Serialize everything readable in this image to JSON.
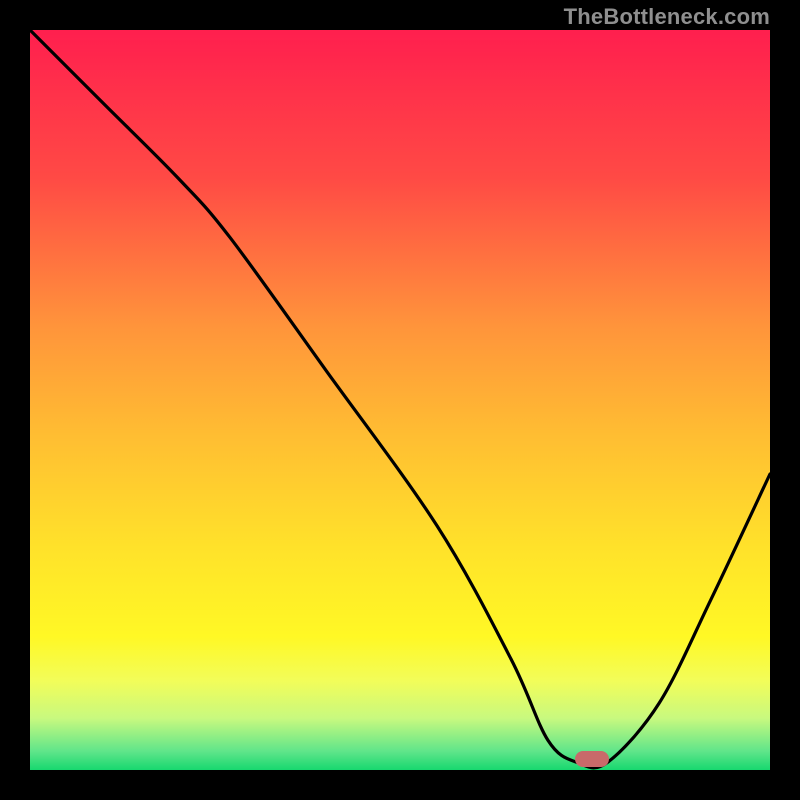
{
  "watermark": "TheBottleneck.com",
  "chart_data": {
    "type": "line",
    "title": "",
    "xlabel": "",
    "ylabel": "",
    "xlim": [
      0,
      100
    ],
    "ylim": [
      0,
      100
    ],
    "series": [
      {
        "name": "bottleneck-curve",
        "x": [
          0,
          10,
          20,
          27,
          40,
          55,
          65,
          70,
          74,
          78,
          85,
          92,
          100
        ],
        "y": [
          100,
          90,
          80,
          72,
          54,
          33,
          15,
          4,
          1,
          1,
          9,
          23,
          40
        ]
      }
    ],
    "marker": {
      "x": 76,
      "y": 1.5
    },
    "gradient_stops": [
      {
        "offset": 0.0,
        "color": "#ff1f4e"
      },
      {
        "offset": 0.2,
        "color": "#ff4a45"
      },
      {
        "offset": 0.4,
        "color": "#ff943b"
      },
      {
        "offset": 0.55,
        "color": "#ffbe32"
      },
      {
        "offset": 0.7,
        "color": "#ffe22a"
      },
      {
        "offset": 0.82,
        "color": "#fff825"
      },
      {
        "offset": 0.88,
        "color": "#f2fd5a"
      },
      {
        "offset": 0.93,
        "color": "#c8f97f"
      },
      {
        "offset": 0.975,
        "color": "#5fe58a"
      },
      {
        "offset": 1.0,
        "color": "#17d86f"
      }
    ]
  }
}
